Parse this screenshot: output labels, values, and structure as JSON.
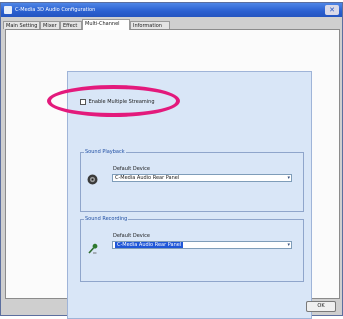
{
  "window": {
    "title": "C-Media 3D Audio Configuration",
    "close_glyph": "✕"
  },
  "tabs": [
    {
      "label": "Main Setting"
    },
    {
      "label": "Mixer"
    },
    {
      "label": "Effect"
    },
    {
      "label": "Multi-Channel"
    },
    {
      "label": "Information"
    }
  ],
  "active_tab": 3,
  "multichannel": {
    "checkbox_label": "Enable Multiple Streaming",
    "checkbox_checked": false,
    "playback": {
      "group_title": "Sound Playback",
      "field_label": "Default Device",
      "device_value": "C-Media Audio Rear Panel",
      "icon": "speaker-icon"
    },
    "recording": {
      "group_title": "Sound Recording",
      "field_label": "Default Device",
      "device_value": "C-Media Audio Rear Panel",
      "icon": "microphone-icon"
    }
  },
  "footer": {
    "ok_label": "OK"
  },
  "colors": {
    "highlight_circle": "#e31a7c",
    "titlebar": "#2a5fd0",
    "panel_bg": "#d9e6f7"
  }
}
